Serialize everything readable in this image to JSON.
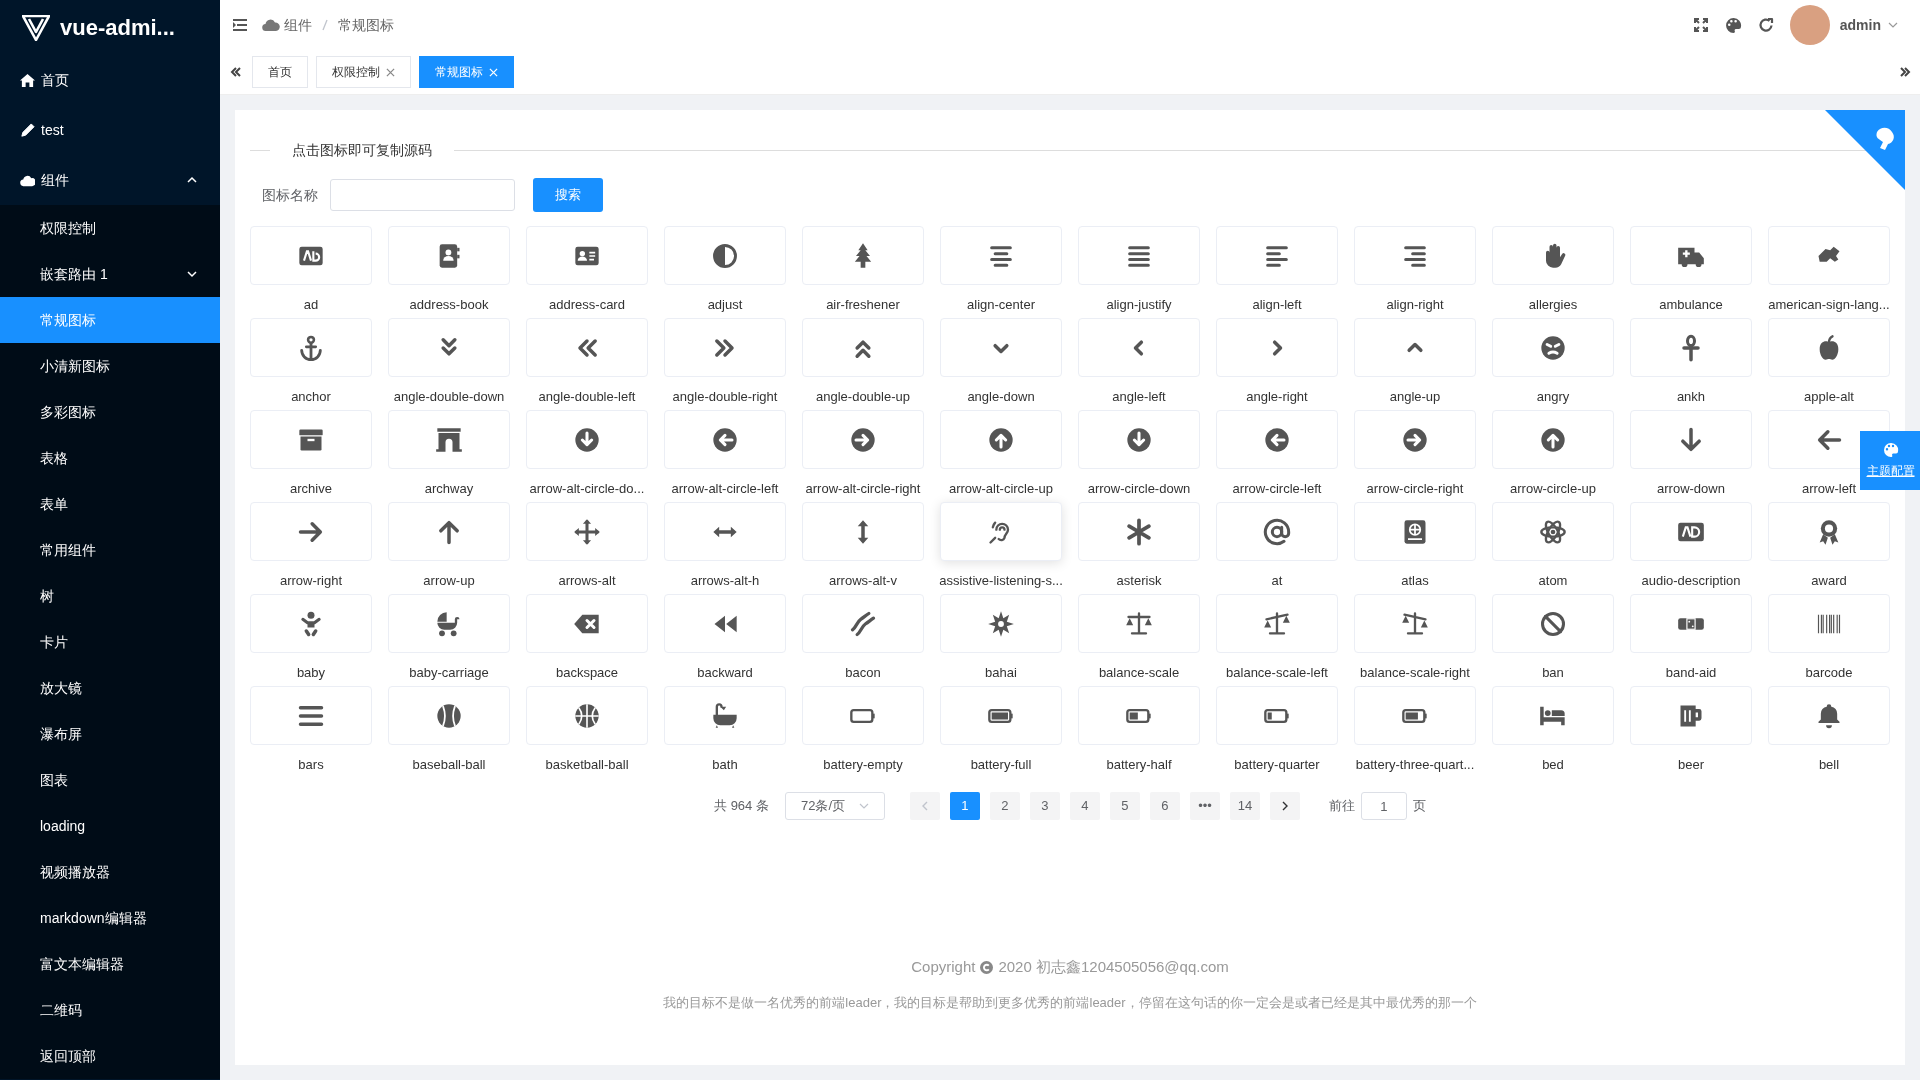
{
  "sidebar": {
    "logo": "vue-admi...",
    "items": [
      {
        "label": "首页",
        "selected": false
      },
      {
        "label": "test",
        "selected": false
      },
      {
        "label": "组件",
        "selected": false,
        "expanded": true,
        "children": [
          {
            "label": "权限控制",
            "selected": false
          },
          {
            "label": "嵌套路由 1",
            "selected": false,
            "expanded": false
          },
          {
            "label": "常规图标",
            "selected": true
          },
          {
            "label": "小清新图标",
            "selected": false
          },
          {
            "label": "多彩图标",
            "selected": false
          },
          {
            "label": "表格",
            "selected": false
          },
          {
            "label": "表单",
            "selected": false
          },
          {
            "label": "常用组件",
            "selected": false
          },
          {
            "label": "树",
            "selected": false
          },
          {
            "label": "卡片",
            "selected": false
          },
          {
            "label": "放大镜",
            "selected": false
          },
          {
            "label": "瀑布屏",
            "selected": false
          },
          {
            "label": "图表",
            "selected": false
          },
          {
            "label": "loading",
            "selected": false
          },
          {
            "label": "视频播放器",
            "selected": false
          },
          {
            "label": "markdown编辑器",
            "selected": false
          },
          {
            "label": "富文本编辑器",
            "selected": false
          },
          {
            "label": "二维码",
            "selected": false
          },
          {
            "label": "返回顶部",
            "selected": false
          }
        ]
      }
    ]
  },
  "breadcrumb": [
    "组件",
    "常规图标"
  ],
  "user": {
    "name": "admin"
  },
  "tabs": [
    {
      "label": "首页",
      "selected": false,
      "closable": false
    },
    {
      "label": "权限控制",
      "selected": false,
      "closable": true
    },
    {
      "label": "常规图标",
      "selected": true,
      "closable": true
    }
  ],
  "panel": {
    "legend": "点击图标即可复制源码",
    "search_label": "图标名称",
    "search_button": "搜索"
  },
  "icons": [
    {
      "name": "ad"
    },
    {
      "name": "address-book"
    },
    {
      "name": "address-card"
    },
    {
      "name": "adjust"
    },
    {
      "name": "air-freshener"
    },
    {
      "name": "align-center"
    },
    {
      "name": "align-justify"
    },
    {
      "name": "align-left"
    },
    {
      "name": "align-right"
    },
    {
      "name": "allergies"
    },
    {
      "name": "ambulance"
    },
    {
      "name": "american-sign-lang..."
    },
    {
      "name": "anchor"
    },
    {
      "name": "angle-double-down"
    },
    {
      "name": "angle-double-left"
    },
    {
      "name": "angle-double-right"
    },
    {
      "name": "angle-double-up"
    },
    {
      "name": "angle-down"
    },
    {
      "name": "angle-left"
    },
    {
      "name": "angle-right"
    },
    {
      "name": "angle-up"
    },
    {
      "name": "angry"
    },
    {
      "name": "ankh"
    },
    {
      "name": "apple-alt"
    },
    {
      "name": "archive"
    },
    {
      "name": "archway"
    },
    {
      "name": "arrow-alt-circle-do..."
    },
    {
      "name": "arrow-alt-circle-left"
    },
    {
      "name": "arrow-alt-circle-right"
    },
    {
      "name": "arrow-alt-circle-up"
    },
    {
      "name": "arrow-circle-down"
    },
    {
      "name": "arrow-circle-left"
    },
    {
      "name": "arrow-circle-right"
    },
    {
      "name": "arrow-circle-up"
    },
    {
      "name": "arrow-down"
    },
    {
      "name": "arrow-left"
    },
    {
      "name": "arrow-right"
    },
    {
      "name": "arrow-up"
    },
    {
      "name": "arrows-alt"
    },
    {
      "name": "arrows-alt-h"
    },
    {
      "name": "arrows-alt-v"
    },
    {
      "name": "assistive-listening-s..."
    },
    {
      "name": "asterisk"
    },
    {
      "name": "at"
    },
    {
      "name": "atlas"
    },
    {
      "name": "atom"
    },
    {
      "name": "audio-description"
    },
    {
      "name": "award"
    },
    {
      "name": "baby"
    },
    {
      "name": "baby-carriage"
    },
    {
      "name": "backspace"
    },
    {
      "name": "backward"
    },
    {
      "name": "bacon"
    },
    {
      "name": "bahai"
    },
    {
      "name": "balance-scale"
    },
    {
      "name": "balance-scale-left"
    },
    {
      "name": "balance-scale-right"
    },
    {
      "name": "ban"
    },
    {
      "name": "band-aid"
    },
    {
      "name": "barcode"
    },
    {
      "name": "bars"
    },
    {
      "name": "baseball-ball"
    },
    {
      "name": "basketball-ball"
    },
    {
      "name": "bath"
    },
    {
      "name": "battery-empty"
    },
    {
      "name": "battery-full"
    },
    {
      "name": "battery-half"
    },
    {
      "name": "battery-quarter"
    },
    {
      "name": "battery-three-quart..."
    },
    {
      "name": "bed"
    },
    {
      "name": "beer"
    },
    {
      "name": "bell"
    }
  ],
  "pagination": {
    "total": "共 964 条",
    "page_size": "72条/页",
    "prev_disabled": true,
    "next_disabled": false,
    "pages": [
      {
        "label": "1",
        "selected": true
      },
      {
        "label": "2",
        "selected": false
      },
      {
        "label": "3",
        "selected": false
      },
      {
        "label": "4",
        "selected": false
      },
      {
        "label": "5",
        "selected": false
      },
      {
        "label": "6",
        "selected": false
      },
      {
        "label": "•••",
        "selected": false
      },
      {
        "label": "14",
        "selected": false
      }
    ],
    "goto_label": "前往",
    "goto_value": "1",
    "goto_suffix": "页"
  },
  "footer": {
    "copyright": "Copyright",
    "owner": "2020 初志鑫1204505056@qq.com",
    "motto": "我的目标不是做一名优秀的前端leader，我的目标是帮助到更多优秀的前端leader，停留在这句话的你一定会是或者已经是其中最优秀的那一个"
  },
  "theme_button": "主题配置"
}
